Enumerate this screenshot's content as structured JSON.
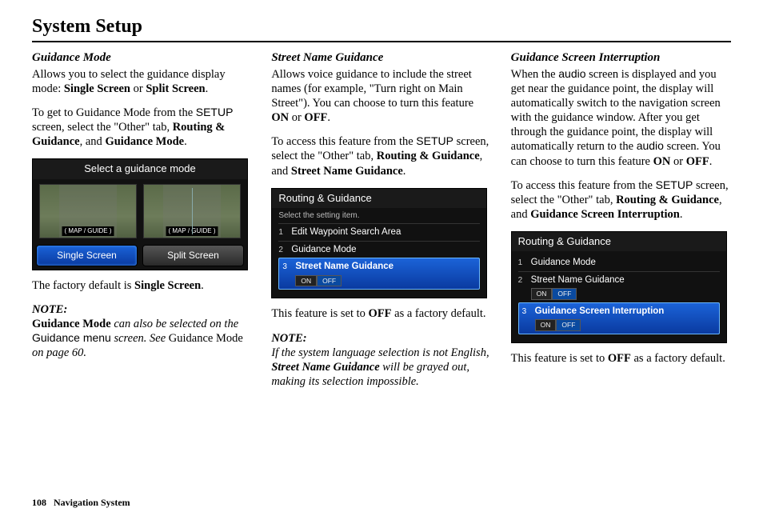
{
  "page_title": "System Setup",
  "footer": {
    "page_number": "108",
    "book_title": "Navigation System"
  },
  "col1": {
    "heading": "Guidance Mode",
    "p1a": "Allows you to select the guidance display mode: ",
    "p1b_bold": "Single Screen",
    "p1c": " or ",
    "p1d_bold": "Split Screen",
    "p1e": ".",
    "p2a": "To get to Guidance Mode from the ",
    "p2_setup": "SETUP",
    "p2b": " screen, select the \"Other\" tab, ",
    "p2c_bold": "Routing & Guidance",
    "p2d": ", and ",
    "p2e_bold": "Guidance Mode",
    "p2f": ".",
    "p3a": "The factory default is ",
    "p3b_bold": "Single Screen",
    "p3c": ".",
    "note_label": "NOTE:",
    "note_a_bold": "Guidance Mode",
    "note_b": " can also be selected on the ",
    "note_c_sans": "Guidance menu",
    "note_d": " screen. See ",
    "note_e_plain": "Guidance Mode",
    "note_f": " on page 60.",
    "screenshot": {
      "title": "Select a guidance mode",
      "preview_labels": {
        "single": "( MAP / GUIDE )",
        "split": "( MAP / GUIDE )"
      },
      "buttons": {
        "single": "Single Screen",
        "split": "Split Screen"
      }
    }
  },
  "col2": {
    "heading": "Street Name Guidance",
    "p1a": "Allows voice guidance to include the street names (for example, \"Turn right on Main Street\"). You can choose to turn this feature ",
    "p1_on": "ON",
    "p1_or": " or ",
    "p1_off": "OFF",
    "p1_end": ".",
    "p2a": "To access this feature from the ",
    "p2_setup": "SETUP",
    "p2b": " screen, select the \"Other\" tab, ",
    "p2c_bold": "Routing & Guidance",
    "p2d": ", and ",
    "p2e_bold": "Street Name Guidance",
    "p2f": ".",
    "p3a": "This feature is set to ",
    "p3_off": "OFF",
    "p3b": " as a factory default.",
    "note_label": "NOTE:",
    "note_a": "If the system language selection is not English, ",
    "note_b_bold": "Street Name Guidance",
    "note_c": " will be grayed out, making its selection impossible.",
    "screenshot": {
      "title": "Routing & Guidance",
      "subtitle": "Select the setting item.",
      "items": [
        {
          "num": "1",
          "label": "Edit Waypoint Search Area"
        },
        {
          "num": "2",
          "label": "Guidance Mode"
        },
        {
          "num": "3",
          "label": "Street Name Guidance",
          "on": "ON",
          "off": "OFF",
          "highlight": true
        }
      ]
    }
  },
  "col3": {
    "heading": "Guidance Screen Interruption",
    "p1a": "When the ",
    "p1_audio1": "audio",
    "p1b": " screen is displayed and you get near the guidance point, the display will automatically switch to the navigation screen with the guidance window. After you get through the guidance point, the display will automatically return to the ",
    "p1_audio2": "audio",
    "p1c": " screen. You can choose to turn this feature ",
    "p1_on": "ON",
    "p1_or": " or ",
    "p1_off": "OFF",
    "p1_end": ".",
    "p2a": "To access this feature from the ",
    "p2_setup": "SETUP",
    "p2b": " screen, select the \"Other\" tab, ",
    "p2c_bold": "Routing & Guidance",
    "p2d": ", and ",
    "p2e_bold": "Guidance Screen Interruption",
    "p2f": ".",
    "p3a": "This feature is set to ",
    "p3_off": "OFF",
    "p3b": " as a factory default.",
    "screenshot": {
      "title": "Routing & Guidance",
      "items": [
        {
          "num": "1",
          "label": "Guidance Mode"
        },
        {
          "num": "2",
          "label": "Street Name Guidance",
          "on": "ON",
          "off": "OFF"
        },
        {
          "num": "3",
          "label": "Guidance Screen Interruption",
          "on": "ON",
          "off": "OFF",
          "highlight": true
        }
      ]
    }
  }
}
